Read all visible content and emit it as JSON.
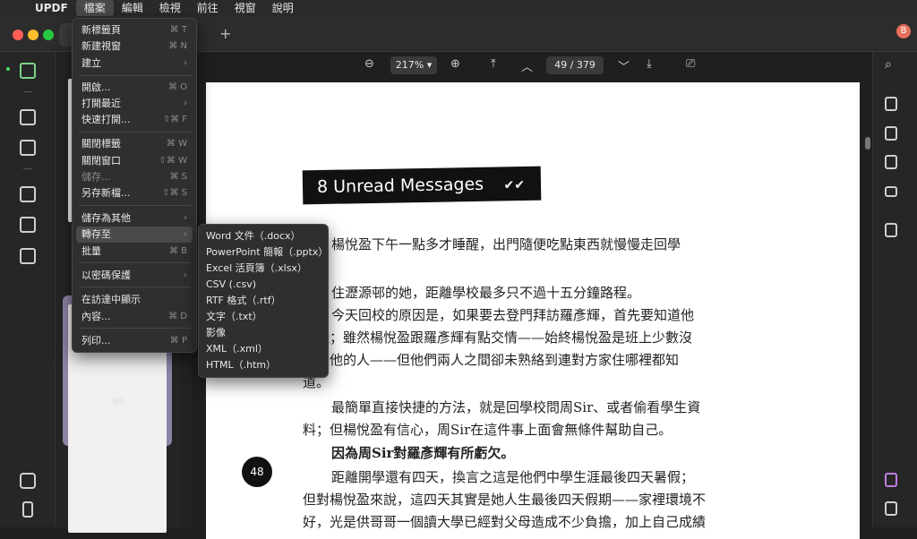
{
  "menubar": {
    "app": "UPDF",
    "items": [
      "檔案",
      "編輯",
      "檢視",
      "前往",
      "視窗",
      "說明"
    ]
  },
  "toolbar": {
    "zoom": "217%",
    "page_current": "49",
    "page_sep": "/",
    "page_total": "379"
  },
  "avatar": "B",
  "thumbnails": {
    "page_label": "49"
  },
  "document": {
    "banner": "8 Unread Messages",
    "paragraphs": [
      "楊悅盈下午一點多才睡醒，出門隨便吃點東西就慢慢走回學",
      "住瀝源邨的她，距離學校最多只不過十五分鐘路程。",
      "今天回校的原因是，如果要去登門拜訪羅彥輝，首先要知道他",
      "地址；雖然楊悅盈跟羅彥輝有點交情——始終楊悅盈是班上少數沒",
      "欺凌他的人——但他們兩人之間卻未熟絡到連對方家住哪裡都知",
      "道。",
      "最簡單直接快捷的方法，就是回學校問周Sir、或者偷看學生資",
      "料；但楊悅盈有信心，周Sir在這件事上面會無條件幫助自己。",
      "因為周Sir對羅彥輝有所虧欠。",
      "距離開學還有四天，換言之這是他們中學生涯最後四天暑假；",
      "但對楊悅盈來說，這四天其實是她人生最後四天假期——家裡環境不",
      "好，光是供哥哥一個讀大學已經對父母造成不少負擔，加上自己成績"
    ],
    "page_badge": "48"
  },
  "file_menu": {
    "items": [
      {
        "label": "新標籤頁",
        "shortcut": "⌘ T"
      },
      {
        "label": "新建視窗",
        "shortcut": "⌘ N"
      },
      {
        "label": "建立",
        "shortcut": "›"
      },
      {
        "label": "開啟...",
        "shortcut": "⌘ O"
      },
      {
        "label": "打開最近",
        "shortcut": "›"
      },
      {
        "label": "快速打開...",
        "shortcut": "⇧⌘ F"
      },
      {
        "label": "關閉標籤",
        "shortcut": "⌘ W"
      },
      {
        "label": "關閉窗口",
        "shortcut": "⇧⌘ W"
      },
      {
        "label": "儲存...",
        "shortcut": "⌘ S"
      },
      {
        "label": "另存新檔...",
        "shortcut": "⇧⌘ S"
      },
      {
        "label": "儲存為其他",
        "shortcut": "›"
      },
      {
        "label": "轉存至",
        "shortcut": "›"
      },
      {
        "label": "批量",
        "shortcut": "⌘ B"
      },
      {
        "label": "以密碼保護",
        "shortcut": "›"
      },
      {
        "label": "在訪達中顯示",
        "shortcut": ""
      },
      {
        "label": "內容...",
        "shortcut": "⌘ D"
      },
      {
        "label": "列印...",
        "shortcut": "⌘ P"
      }
    ]
  },
  "export_submenu": {
    "items": [
      "Word 文件（.docx）",
      "PowerPoint 簡報（.pptx）",
      "Excel 活頁簿（.xlsx）",
      "CSV (.csv)",
      "RTF 格式（.rtf）",
      "文字（.txt）",
      "影像",
      "XML（.xml）",
      "HTML（.htm）"
    ]
  }
}
